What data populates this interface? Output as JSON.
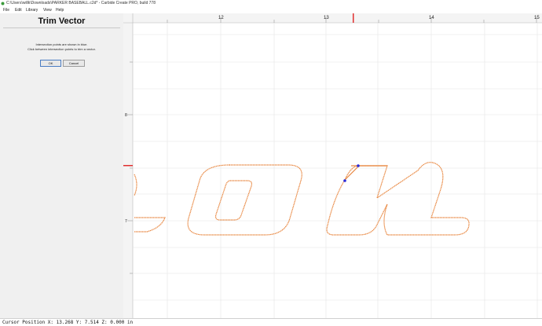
{
  "window": {
    "title": "C:\\Users\\willk\\Downloads\\PARKER BASEBALL.c2d* - Carbide Create PRO, build 778"
  },
  "menu": {
    "items": [
      "File",
      "Edit",
      "Library",
      "View",
      "Help"
    ]
  },
  "panel": {
    "heading": "Trim Vector",
    "info_line1": "Intersection points are shown in blue.",
    "info_line2": "Click between intersection points to trim a vector.",
    "ok_label": "OK",
    "cancel_label": "Cancel"
  },
  "ruler": {
    "top_labels": [
      "12",
      "13",
      "14",
      "15"
    ],
    "left_labels": [
      "8",
      "7"
    ],
    "cursor_x": "13.268",
    "cursor_y": "7.514"
  },
  "status": {
    "cursor_text": "Cursor Position X: 13.268 Y: 7.514 Z: 0.000 in"
  },
  "colors": {
    "vector": "#e8853d",
    "intersection": "#2a2ad8",
    "cursor_marker": "#e03030",
    "grid": "#e4e4e4"
  }
}
